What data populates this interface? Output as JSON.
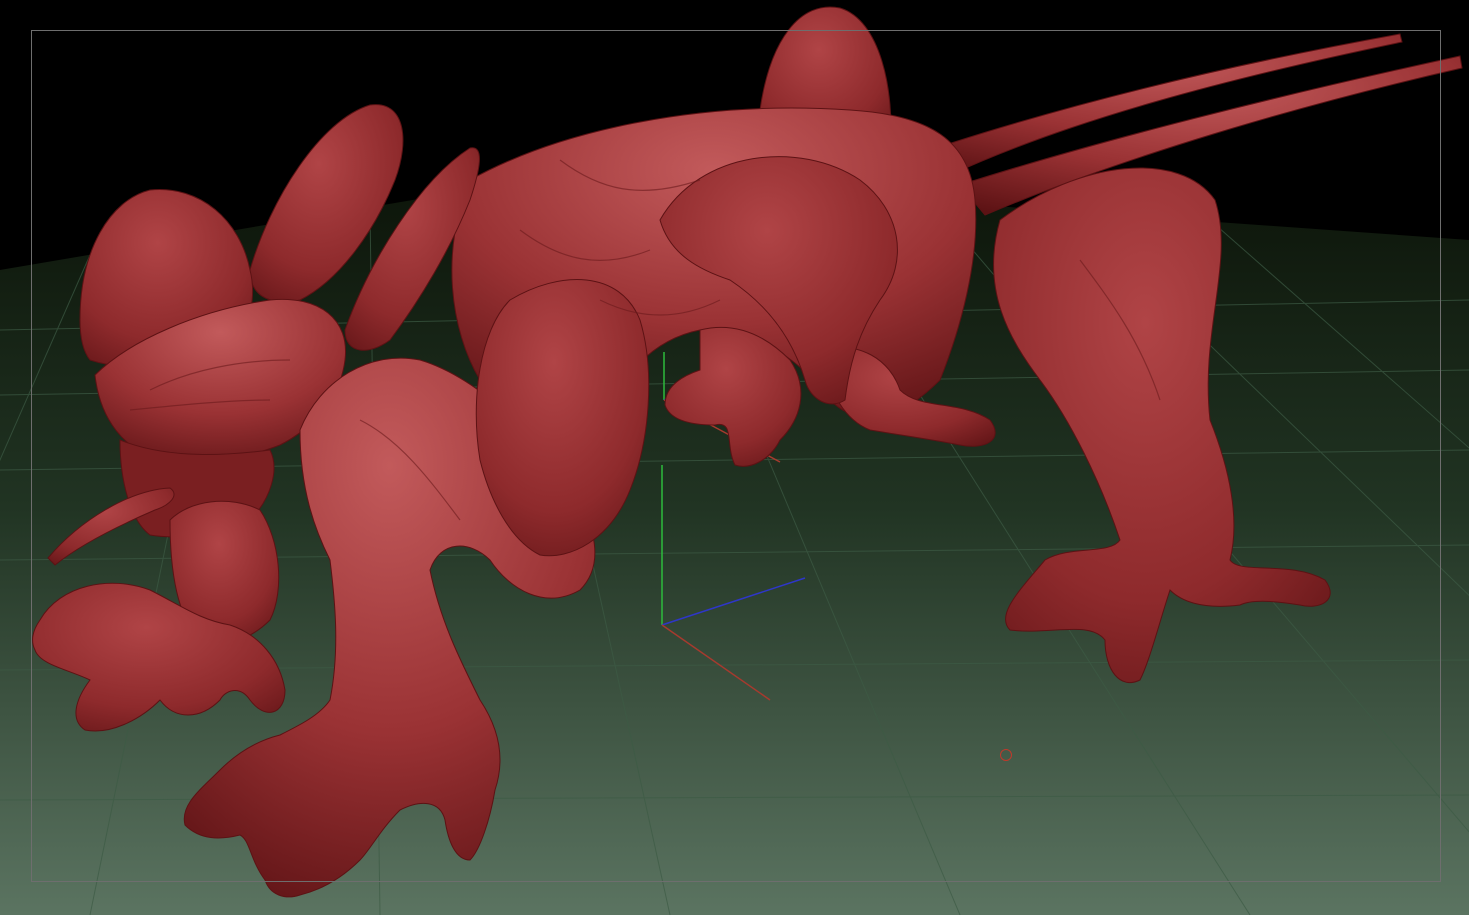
{
  "colors": {
    "background": "#000000",
    "floor_far": "#0c1409",
    "floor_mid": "#213423",
    "floor_near": "#5b7461",
    "grid_line": "#3d5b45",
    "model_base": "#8e2a2c",
    "model_light": "#b04446",
    "model_dark": "#5c1214",
    "model_highlight": "#c25a5b",
    "axis_x": "#a63a2e",
    "axis_y": "#2dbb3c",
    "axis_z": "#2e36c8",
    "brush_cursor": "#c0392b",
    "frame_border": "#6e6e6e"
  },
  "icons": {
    "brush_cursor": "brush-cursor-icon"
  }
}
